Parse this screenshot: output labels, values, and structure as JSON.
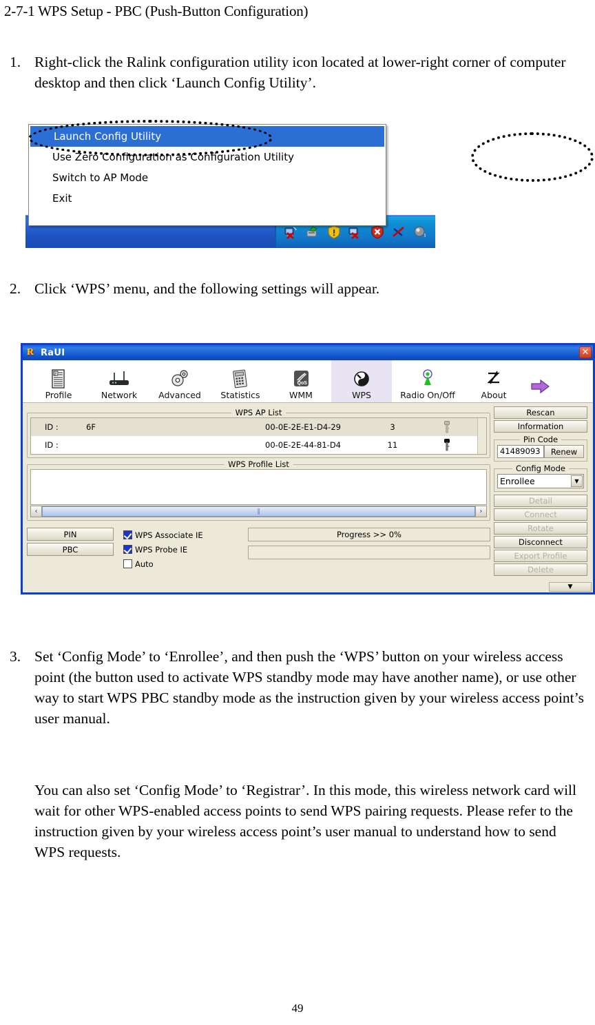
{
  "document": {
    "title": "2-7-1 WPS Setup - PBC (Push-Button Configuration)",
    "page_number": "49",
    "steps": [
      {
        "number": "1.",
        "text": "Right-click the Ralink configuration utility icon located at lower-right corner of computer desktop and then click ‘Launch Config Utility’."
      },
      {
        "number": "2.",
        "text": "Click ‘WPS’ menu, and the following settings will appear."
      },
      {
        "number": "3.",
        "text": "Set ‘Config Mode’ to ‘Enrollee’, and then push the ‘WPS’ button on your wireless access point (the button used to activate WPS standby mode may have another name), or use other way to start WPS PBC standby mode as the instruction given by your wireless access point’s user manual."
      }
    ],
    "paragraph": "You can also set ‘Config Mode’ to ‘Registrar’. In this mode, this wireless network card will wait for other WPS-enabled access points to send WPS pairing requests. Please refer to the instruction given by your wireless access point’s user manual to understand how to send WPS requests."
  },
  "tray_menu": {
    "items": [
      {
        "label": "Launch Config Utility",
        "selected": true
      },
      {
        "label": "Use Zero Configuration as Configuration Utility",
        "selected": false
      },
      {
        "label": "Switch to AP Mode",
        "selected": false
      },
      {
        "label": "Exit",
        "selected": false
      }
    ],
    "tray_icons": [
      "network-disconnected-icon",
      "usb-device-icon",
      "warning-shield-icon",
      "network-error-icon",
      "security-alert-icon",
      "wireless-off-icon",
      "volume-icon"
    ],
    "highlight_color": "#2b6fd4",
    "taskbar_color": "#1f54c4"
  },
  "raui": {
    "window_title": "RaUI",
    "logo_letter": "R",
    "close_label": "✕",
    "toolbar": [
      {
        "label": "Profile",
        "icon": "profile-icon",
        "active": false
      },
      {
        "label": "Network",
        "icon": "router-icon",
        "active": false
      },
      {
        "label": "Advanced",
        "icon": "gears-icon",
        "active": false
      },
      {
        "label": "Statistics",
        "icon": "calculator-icon",
        "active": false
      },
      {
        "label": "WMM",
        "icon": "qos-icon",
        "active": false
      },
      {
        "label": "WPS",
        "icon": "wps-icon",
        "active": true
      },
      {
        "label": "Radio On/Off",
        "icon": "antenna-icon",
        "active": false
      },
      {
        "label": "About",
        "icon": "signature-icon",
        "active": false
      }
    ],
    "expand_icon": "arrow-right-icon",
    "ap_list": {
      "legend": "WPS AP List",
      "rows": [
        {
          "id_label": "ID :",
          "ssid": "6F",
          "mac": "00-0E-2E-E1-D4-29",
          "channel": "3",
          "key": "key-icon",
          "selected": true
        },
        {
          "id_label": "ID :",
          "ssid": "",
          "mac": "00-0E-2E-44-81-D4",
          "channel": "11",
          "key": "key-icon",
          "selected": false
        }
      ]
    },
    "profile_list": {
      "legend": "WPS Profile List",
      "rows": [],
      "scroll_left": "‹",
      "scroll_right": "›",
      "grip": "‖"
    },
    "actions": {
      "pin_label": "PIN",
      "pbc_label": "PBC"
    },
    "checkboxes": [
      {
        "label": "WPS Associate IE",
        "checked": true
      },
      {
        "label": "WPS Probe IE",
        "checked": true
      },
      {
        "label": "Auto",
        "checked": false
      }
    ],
    "progress": {
      "text": "Progress >> 0%",
      "value": 0
    },
    "side_buttons_top": [
      {
        "label": "Rescan",
        "disabled": false
      },
      {
        "label": "Information",
        "disabled": false
      }
    ],
    "pin_code": {
      "legend": "Pin Code",
      "value": "41489093",
      "renew_label": "Renew"
    },
    "config_mode": {
      "legend": "Config Mode",
      "value": "Enrollee",
      "options": [
        "Enrollee",
        "Registrar"
      ],
      "arrow": "▼"
    },
    "side_buttons_bottom": [
      {
        "label": "Detail",
        "disabled": true
      },
      {
        "label": "Connect",
        "disabled": true
      },
      {
        "label": "Rotate",
        "disabled": true
      },
      {
        "label": "Disconnect",
        "disabled": false
      },
      {
        "label": "Export Profile",
        "disabled": true
      },
      {
        "label": "Delete",
        "disabled": true
      }
    ],
    "expand_button": {
      "icon": "chevron-down-icon",
      "label": "▼"
    },
    "colors": {
      "title_blue": "#1153c8",
      "window_face": "#ece9d8",
      "active_tab": "#e8e4f4",
      "checkbox_blue": "#1b36c8",
      "border_blue": "#0a3fd0"
    }
  },
  "annotations": [
    {
      "name": "launch-config-utility-ellipse",
      "shape": "dotted-ellipse"
    },
    {
      "name": "config-mode-ellipse",
      "shape": "dotted-ellipse"
    }
  ]
}
